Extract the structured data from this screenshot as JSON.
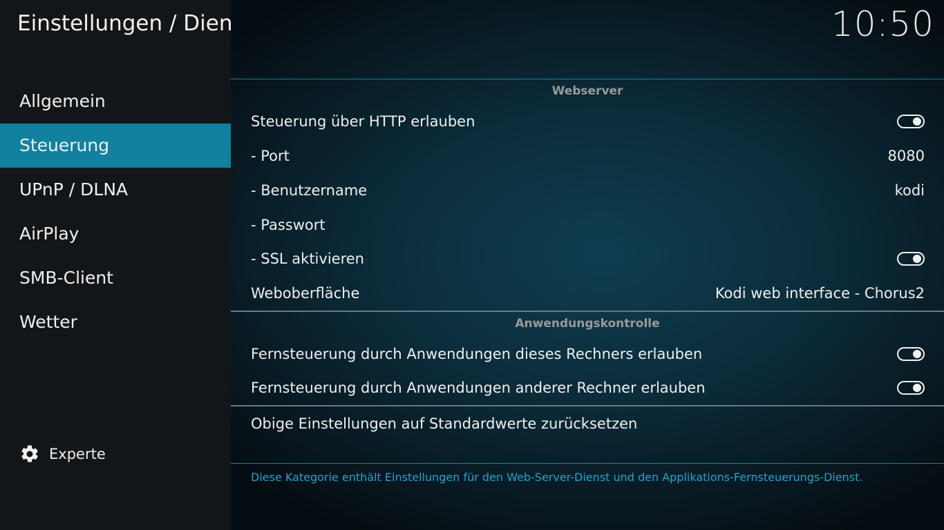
{
  "header": {
    "title": "Einstellungen / Dienste",
    "clock": "10:50"
  },
  "sidebar": {
    "items": [
      {
        "label": "Allgemein",
        "active": false
      },
      {
        "label": "Steuerung",
        "active": true
      },
      {
        "label": "UPnP / DLNA",
        "active": false
      },
      {
        "label": "AirPlay",
        "active": false
      },
      {
        "label": "SMB-Client",
        "active": false
      },
      {
        "label": "Wetter",
        "active": false
      }
    ],
    "level": {
      "label": "Experte",
      "icon": "gear-icon"
    }
  },
  "webserver": {
    "header": "Webserver",
    "rows": [
      {
        "label": "Steuerung über HTTP erlauben",
        "type": "toggle",
        "on": true
      },
      {
        "label": "- Port",
        "value": "8080"
      },
      {
        "label": "- Benutzername",
        "value": "kodi"
      },
      {
        "label": "- Passwort",
        "value": ""
      },
      {
        "label": "- SSL aktivieren",
        "type": "toggle",
        "on": true
      },
      {
        "label": "Weboberfläche",
        "value": "Kodi web interface - Chorus2"
      }
    ]
  },
  "appcontrol": {
    "header": "Anwendungskontrolle",
    "rows": [
      {
        "label": "Fernsteuerung durch Anwendungen dieses Rechners erlauben",
        "type": "toggle",
        "on": true
      },
      {
        "label": "Fernsteuerung durch Anwendungen anderer Rechner erlauben",
        "type": "toggle",
        "on": true
      }
    ]
  },
  "reset": {
    "label": "Obige Einstellungen auf Standardwerte zurücksetzen"
  },
  "description": "Diese Kategorie enthält Einstellungen für den Web-Server-Dienst und den Applikations-Fernsteuerungs-Dienst.",
  "colors": {
    "accent": "#12819f",
    "description": "#1ba6cd",
    "section_header": "#9a9a9a"
  }
}
